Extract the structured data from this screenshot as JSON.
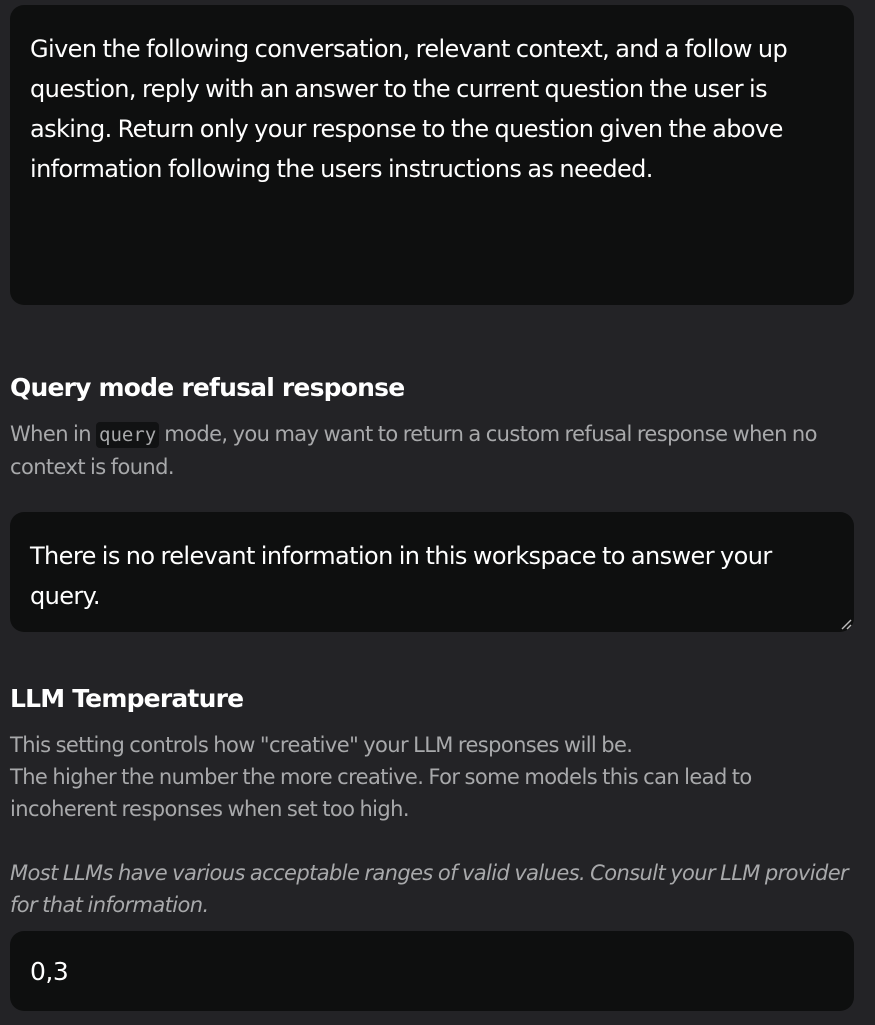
{
  "prompt": {
    "value": "Given the following conversation, relevant context, and a follow up question, reply with an answer to the current question the user is asking. Return only your response to the question given the above information following the users instructions as needed."
  },
  "refusal": {
    "title": "Query mode refusal response",
    "desc_prefix": "When in ",
    "desc_code": "query",
    "desc_suffix": " mode, you may want to return a custom refusal response when no context is found.",
    "value": "There is no relevant information in this workspace to answer your query."
  },
  "temperature": {
    "title": "LLM Temperature",
    "desc_line1": "This setting controls how \"creative\" your LLM responses will be.",
    "desc_line2": "The higher the number the more creative. For some models this can lead to incoherent responses when set too high.",
    "note": "Most LLMs have various acceptable ranges of valid values. Consult your LLM provider for that information.",
    "value": "0,3"
  }
}
